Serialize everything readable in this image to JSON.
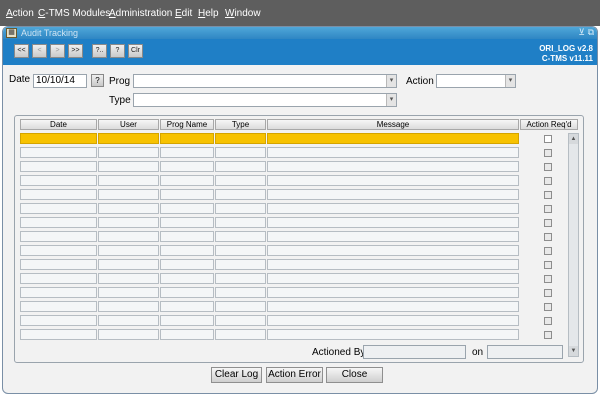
{
  "menu": {
    "items": [
      {
        "mnemonic": "A",
        "rest": "ction"
      },
      {
        "mnemonic": "C",
        "rest": "-TMS Modules"
      },
      {
        "mnemonic": "A",
        "rest": "dministration"
      },
      {
        "mnemonic": "E",
        "rest": "dit"
      },
      {
        "mnemonic": "H",
        "rest": "elp"
      },
      {
        "mnemonic": "W",
        "rest": "indow"
      }
    ]
  },
  "window": {
    "title": "Audit Tracking",
    "icons": {
      "app": "app-form-icon",
      "minimize": "minimize-icon",
      "restore": "restore-icon"
    }
  },
  "toolbar": {
    "buttons": [
      "<<",
      "<",
      ">",
      ">>",
      "?..",
      "?",
      "Clr"
    ],
    "version_line1": "ORI_LOG v2.8",
    "version_line2": "C-TMS v11.11"
  },
  "filters": {
    "date_label": "Date",
    "date_value": "10/10/14",
    "help_button": "?",
    "prog_label": "Prog",
    "prog_value": "",
    "action_label": "Action",
    "action_value": "",
    "type_label": "Type",
    "type_value": ""
  },
  "grid": {
    "columns": [
      "Date",
      "User",
      "Prog Name",
      "Type",
      "Message",
      "Action Req'd"
    ],
    "row_count": 15,
    "selected_row": 0
  },
  "footer": {
    "actioned_by_label": "Actioned By",
    "actioned_by_value": "",
    "on_label": "on",
    "on_value": "",
    "buttons": {
      "clear_log": "Clear Log",
      "action_error": "Action Error",
      "close": "Close"
    }
  },
  "colors": {
    "menubar": "#5e5e5e",
    "toolbar": "#1f7fc6",
    "selected_row": "#f7c200"
  }
}
